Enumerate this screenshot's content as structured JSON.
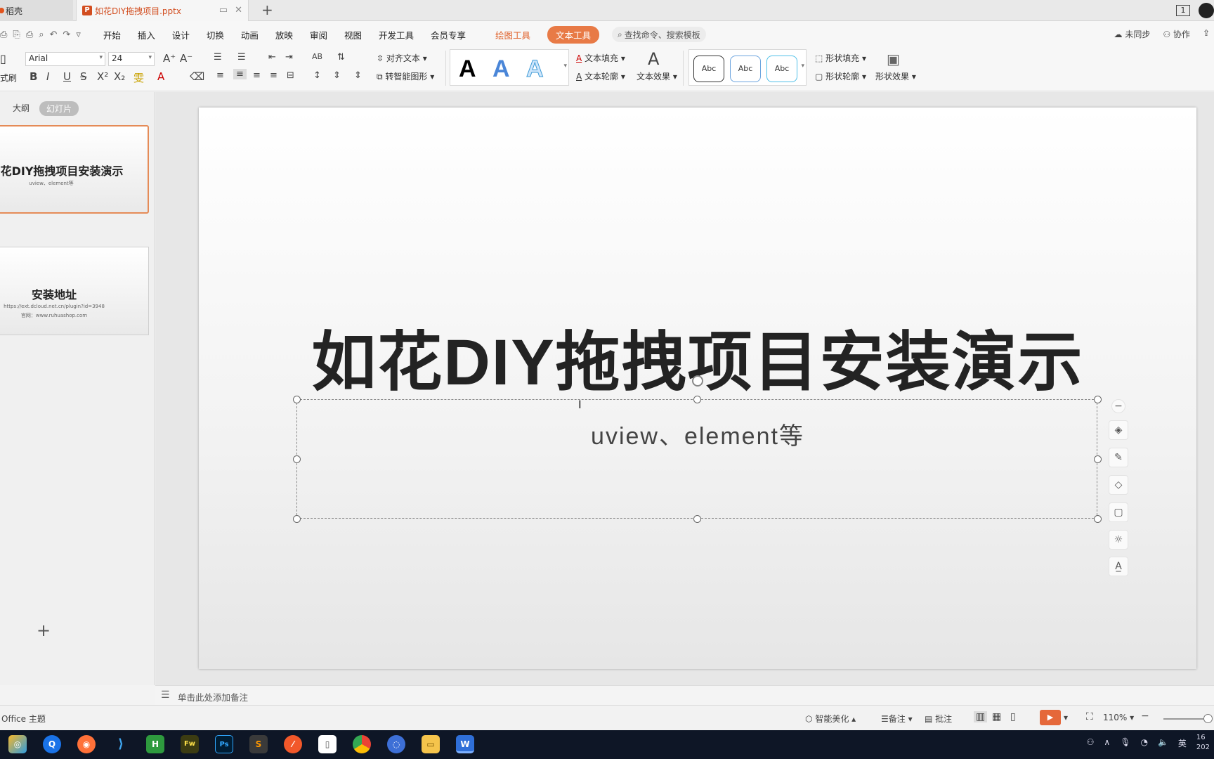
{
  "tabs": {
    "home": "稻壳",
    "doc": "如花DIY拖拽项目.pptx",
    "new_tab": "+"
  },
  "menu": {
    "items": [
      "开始",
      "插入",
      "设计",
      "切换",
      "动画",
      "放映",
      "审阅",
      "视图",
      "开发工具",
      "会员专享"
    ],
    "drawing_tools": "绘图工具",
    "text_tools": "文本工具",
    "search_placeholder": "查找命令、搜索模板",
    "unsynced": "未同步",
    "collab": "协作"
  },
  "ribbon": {
    "format_painter": "式刷",
    "font": "Arial",
    "font_size": "24",
    "align_text": "对齐文本",
    "smart_art": "转智能图形",
    "text_fill": "文本填充",
    "text_outline": "文本轮廓",
    "text_effect": "文本效果",
    "abc": "Abc",
    "shape_fill": "形状填充",
    "shape_outline": "形状轮廓",
    "shape_effect": "形状效果",
    "big_a": "A"
  },
  "panel": {
    "outline_tab": "大纲",
    "slides_tab": "幻灯片",
    "add_slide": "+"
  },
  "thumbnails": [
    {
      "title": "花DIY拖拽项目安装演示",
      "sub": "uview、element等"
    },
    {
      "title": "安装地址",
      "sub1": "https://ext.dcloud.net.cn/plugin?id=3948",
      "sub2": "官网：www.ruhuashop.com"
    }
  ],
  "slide": {
    "title": "如花DIY拖拽项目安装演示",
    "subtitle": "uview、element等"
  },
  "notes": {
    "placeholder": "单击此处添加备注"
  },
  "status": {
    "theme": "Office 主题",
    "smart_beautify": "智能美化",
    "notes": "备注",
    "comments": "批注",
    "zoom": "110%"
  },
  "tray": {
    "lang": "英",
    "time_a": "16",
    "time_b": "202"
  },
  "colors": {
    "accent": "#e0622b",
    "slide_title": "#232323"
  }
}
